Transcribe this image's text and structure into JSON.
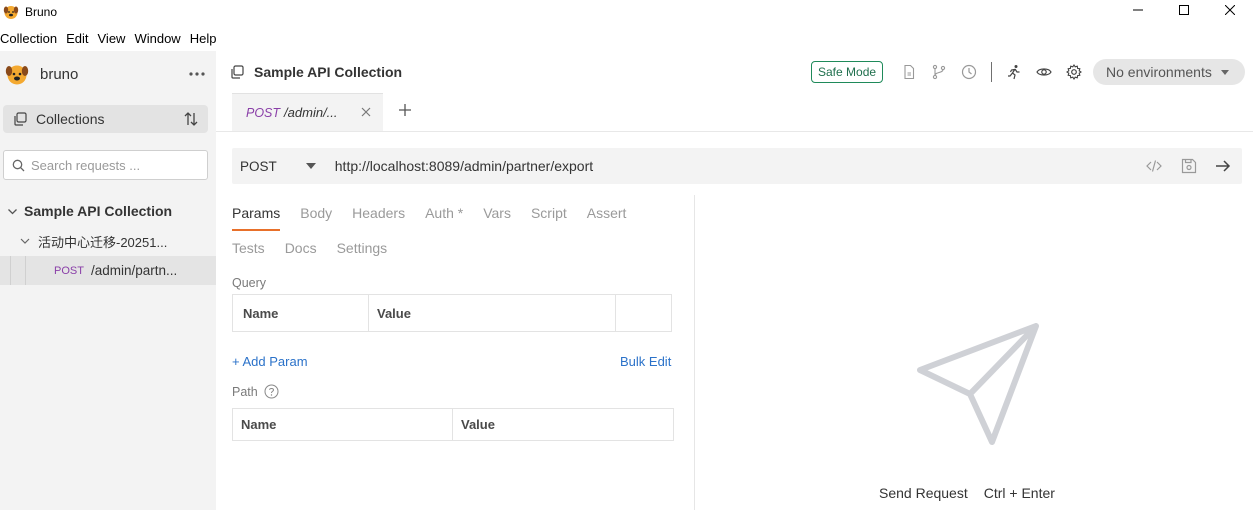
{
  "window": {
    "title": "Bruno"
  },
  "menu": [
    "Collection",
    "Edit",
    "View",
    "Window",
    "Help"
  ],
  "sidebar": {
    "brand": "bruno",
    "collections_label": "Collections",
    "search_placeholder": "Search requests ...",
    "tree": {
      "collection": "Sample API Collection",
      "folder": "活动中心迁移-20251...",
      "request": {
        "method": "POST",
        "path": "/admin/partn..."
      }
    }
  },
  "header": {
    "collection_title": "Sample API Collection",
    "safe_mode": "Safe Mode",
    "environment": "No environments"
  },
  "tabs": [
    {
      "method": "POST",
      "path": "/admin/..."
    }
  ],
  "request": {
    "method": "POST",
    "url": "http://localhost:8089/admin/partner/export",
    "tabs_row1": [
      "Params",
      "Body",
      "Headers",
      "Auth *",
      "Vars",
      "Script",
      "Assert"
    ],
    "tabs_row2": [
      "Tests",
      "Docs",
      "Settings"
    ],
    "active_tab": "Params",
    "query": {
      "label": "Query",
      "columns": [
        "Name",
        "Value"
      ]
    },
    "add_param": "+ Add Param",
    "bulk_edit": "Bulk Edit",
    "path": {
      "label": "Path",
      "columns": [
        "Name",
        "Value"
      ]
    }
  },
  "response": {
    "send_label": "Send Request",
    "shortcut": "Ctrl + Enter"
  },
  "colors": {
    "sidebar_bg": "#f3f3f3",
    "method_post": "#8a3fa8",
    "active_tab_underline": "#e8702a",
    "link": "#2b72c9",
    "safe_mode": "#1f8a5a"
  }
}
